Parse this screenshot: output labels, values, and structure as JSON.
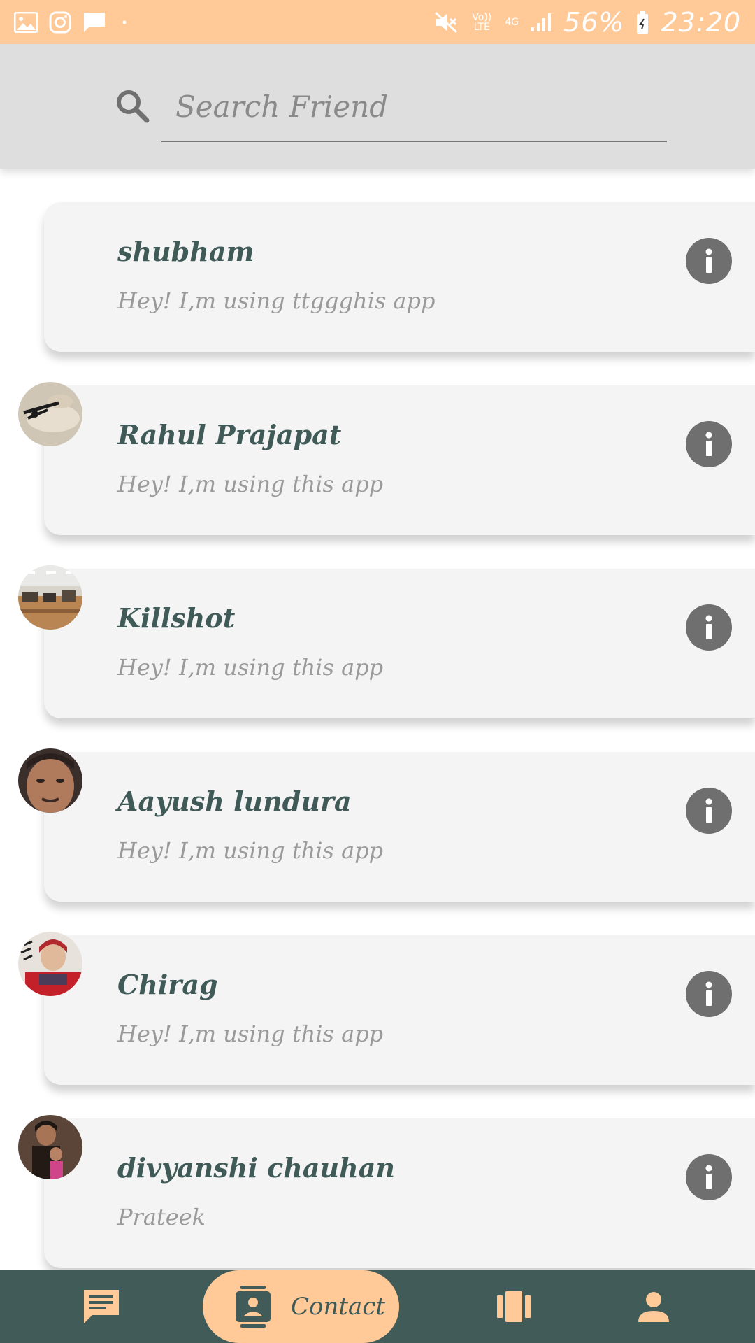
{
  "status_bar": {
    "battery_percent": "56%",
    "time": "23:20",
    "volte_label": "Vo)) LTE",
    "network_label": "4G"
  },
  "search": {
    "placeholder": "Search Friend",
    "icon": "search-icon"
  },
  "contacts": [
    {
      "name": "shubham",
      "status": "Hey! I,m using ttggghis app",
      "has_avatar": false
    },
    {
      "name": "Rahul Prajapat",
      "status": "Hey! I,m using this app",
      "has_avatar": true
    },
    {
      "name": "Killshot",
      "status": "Hey! I,m using this app",
      "has_avatar": true
    },
    {
      "name": "Aayush lundura",
      "status": "Hey! I,m using this app",
      "has_avatar": true
    },
    {
      "name": "Chirag",
      "status": "Hey! I,m using this app",
      "has_avatar": true
    },
    {
      "name": "divyanshi chauhan",
      "status": "Prateek",
      "has_avatar": true
    }
  ],
  "bottom_nav": {
    "items": [
      {
        "icon": "chat-icon",
        "label": ""
      },
      {
        "icon": "contact-icon",
        "label": "Contact",
        "active": true
      },
      {
        "icon": "stories-icon",
        "label": ""
      },
      {
        "icon": "profile-icon",
        "label": ""
      }
    ]
  },
  "colors": {
    "accent": "#ffc998",
    "nav_background": "#415b58",
    "name_text": "#3f5a57",
    "status_text": "#9a9a9a",
    "card_background": "#f4f4f4",
    "info_button": "#6f6f6f"
  }
}
